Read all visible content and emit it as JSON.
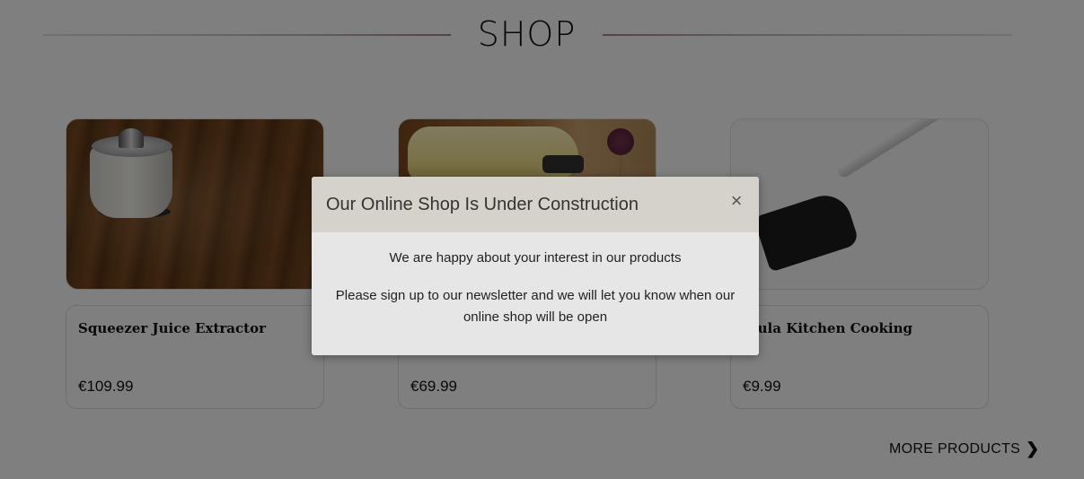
{
  "shop": {
    "title": "SHOP"
  },
  "products": [
    {
      "name": "Squeezer Juice Extractor",
      "price": "€109.99",
      "image_icon": "juicer-image"
    },
    {
      "name": "",
      "price": "€69.99",
      "image_icon": "mixer-image"
    },
    {
      "name": "atula Kitchen Cooking",
      "price": "€9.99",
      "image_icon": "spatula-image"
    }
  ],
  "more_products": {
    "label": "MORE PRODUCTS",
    "icon": "chevron-right-icon"
  },
  "modal": {
    "title": "Our Online Shop Is Under Construction",
    "close_symbol": "×",
    "message1": "We are happy about your interest in our products",
    "message2": "Please sign up to our newsletter and we will let you know when our online shop will be open"
  },
  "colors": {
    "overlay": "rgba(0,0,0,0.5)",
    "modal_header": "#d5d1cb",
    "modal_body": "#e6e6e6"
  }
}
